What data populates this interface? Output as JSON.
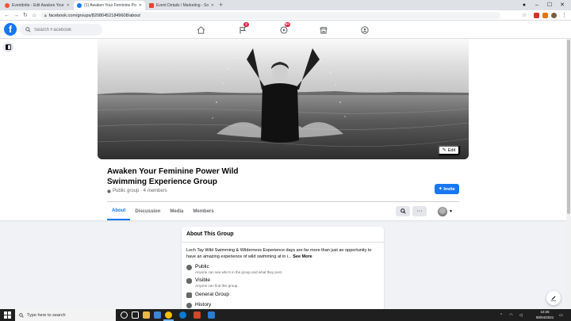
{
  "browser": {
    "tabs": [
      {
        "title": "Eventbrite - Edit Awaken Your Fe…",
        "favicon_color": "#f05537",
        "active": false
      },
      {
        "title": "(1) Awaken Your Feminine Powe…",
        "favicon_color": "#1877f2",
        "active": true
      },
      {
        "title": "Event Details / Marketing - Sogh…",
        "favicon_color": "#ea4335",
        "active": false
      }
    ],
    "new_tab": "+",
    "url": "facebook.com/groups/820804521849608/about"
  },
  "fb_nav": {
    "logo": "f",
    "search_placeholder": "Search Facebook",
    "badges": {
      "flag": "2",
      "watch": "9+"
    }
  },
  "cover": {
    "edit_label": "Edit"
  },
  "group": {
    "title": "Awaken Your Feminine Power Wild Swimming Experience Group",
    "meta": "Public group · 4 members",
    "invite_label": "Invite"
  },
  "tabs": [
    {
      "label": "About",
      "active": true
    },
    {
      "label": "Discussion",
      "active": false
    },
    {
      "label": "Media",
      "active": false
    },
    {
      "label": "Members",
      "active": false
    }
  ],
  "about": {
    "heading": "About This Group",
    "description": "Loch Tay Wild Swimming & Wilderness Experience days are far more than just an opportunity to have an amazing experience of wild swimming at in i...",
    "see_more": "See More",
    "items": [
      {
        "title": "Public",
        "subtitle": "Anyone can see who's in the group and what they post."
      },
      {
        "title": "Visible",
        "subtitle": "Anyone can find this group."
      },
      {
        "title": "General Group",
        "subtitle": ""
      },
      {
        "title": "History",
        "subtitle": ""
      }
    ]
  },
  "taskbar": {
    "search_placeholder": "Type here to search",
    "time": "10:25",
    "date": "08/04/2021"
  },
  "colors": {
    "fb_blue": "#1877f2",
    "badge_red": "#e41e3f",
    "page_bg": "#f0f2f5"
  }
}
